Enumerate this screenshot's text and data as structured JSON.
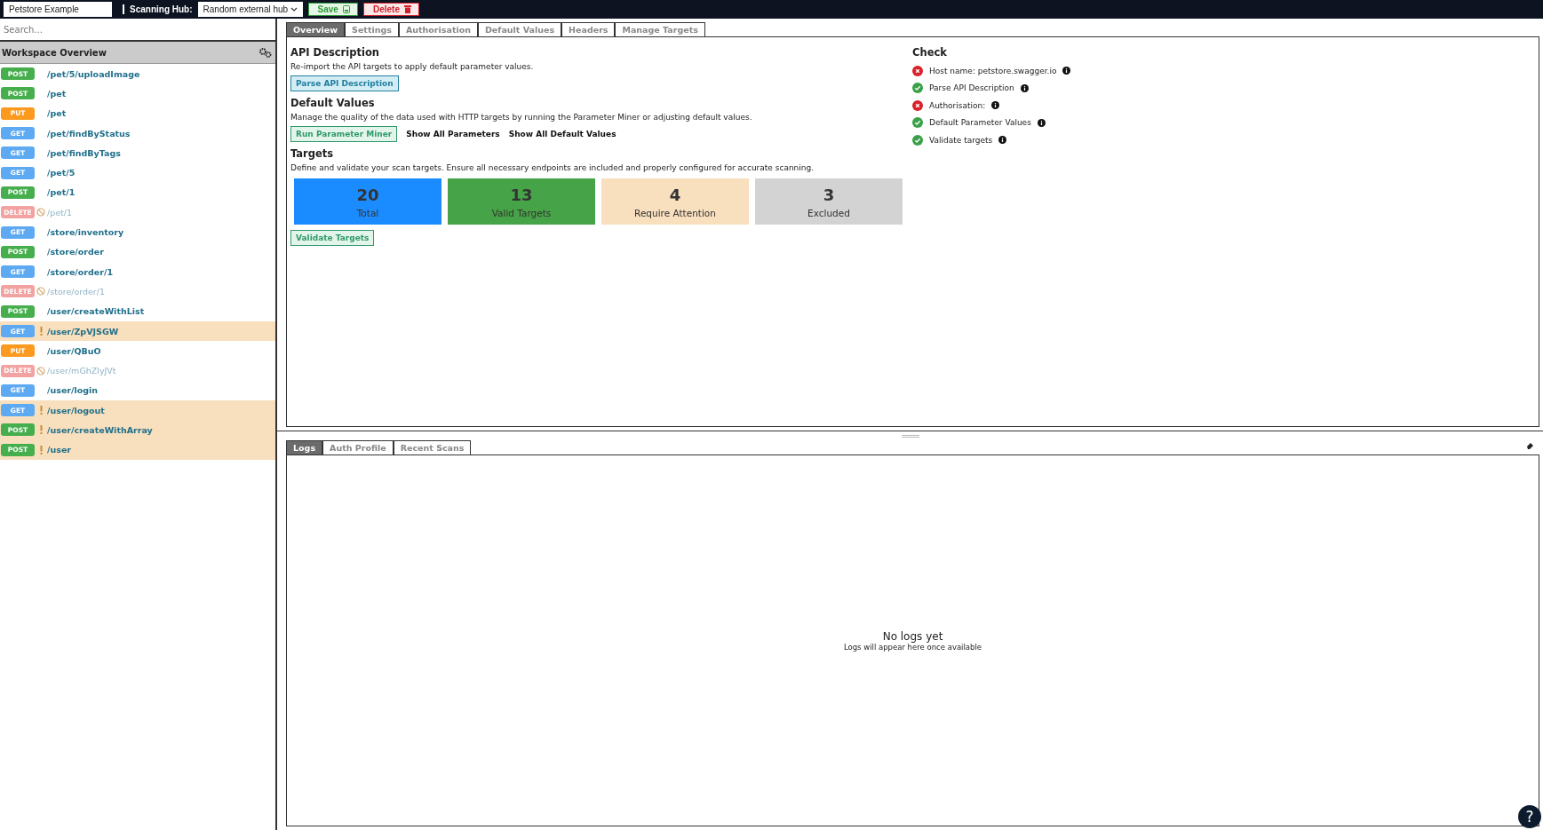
{
  "topbar": {
    "workspace_name": "Petstore Example",
    "hub_label": "Scanning Hub:",
    "hub_value": "Random external hub",
    "save": "Save",
    "delete": "Delete"
  },
  "sidebar": {
    "search_placeholder": "Search...",
    "title": "Workspace Overview",
    "endpoints": [
      {
        "method": "POST",
        "color": "#47ae4e",
        "path": "/pet/5/uploadImage",
        "kind": "normal"
      },
      {
        "method": "POST",
        "color": "#47ae4e",
        "path": "/pet",
        "kind": "normal"
      },
      {
        "method": "PUT",
        "color": "#fb9a1f",
        "path": "/pet",
        "kind": "normal"
      },
      {
        "method": "GET",
        "color": "#5eaaf2",
        "path": "/pet/findByStatus",
        "kind": "normal"
      },
      {
        "method": "GET",
        "color": "#5eaaf2",
        "path": "/pet/findByTags",
        "kind": "normal"
      },
      {
        "method": "GET",
        "color": "#5eaaf2",
        "path": "/pet/5",
        "kind": "normal"
      },
      {
        "method": "POST",
        "color": "#47ae4e",
        "path": "/pet/1",
        "kind": "normal"
      },
      {
        "method": "DELETE",
        "color": "#f3a2a2",
        "path": "/pet/1",
        "kind": "excluded"
      },
      {
        "method": "GET",
        "color": "#5eaaf2",
        "path": "/store/inventory",
        "kind": "normal"
      },
      {
        "method": "POST",
        "color": "#47ae4e",
        "path": "/store/order",
        "kind": "normal"
      },
      {
        "method": "GET",
        "color": "#5eaaf2",
        "path": "/store/order/1",
        "kind": "normal"
      },
      {
        "method": "DELETE",
        "color": "#f3a2a2",
        "path": "/store/order/1",
        "kind": "excluded"
      },
      {
        "method": "POST",
        "color": "#47ae4e",
        "path": "/user/createWithList",
        "kind": "normal"
      },
      {
        "method": "GET",
        "color": "#5eaaf2",
        "path": "/user/ZpVJSGW",
        "kind": "attention"
      },
      {
        "method": "PUT",
        "color": "#fb9a1f",
        "path": "/user/QBuO",
        "kind": "normal"
      },
      {
        "method": "DELETE",
        "color": "#f3a2a2",
        "path": "/user/mGhZlyJVt",
        "kind": "excluded"
      },
      {
        "method": "GET",
        "color": "#5eaaf2",
        "path": "/user/login",
        "kind": "normal"
      },
      {
        "method": "GET",
        "color": "#5eaaf2",
        "path": "/user/logout",
        "kind": "attention"
      },
      {
        "method": "POST",
        "color": "#47ae4e",
        "path": "/user/createWithArray",
        "kind": "attention"
      },
      {
        "method": "POST",
        "color": "#47ae4e",
        "path": "/user",
        "kind": "attention"
      }
    ]
  },
  "tabs": [
    {
      "label": "Overview",
      "selected": true
    },
    {
      "label": "Settings",
      "selected": false
    },
    {
      "label": "Authorisation",
      "selected": false
    },
    {
      "label": "Default Values",
      "selected": false
    },
    {
      "label": "Headers",
      "selected": false
    },
    {
      "label": "Manage Targets",
      "selected": false
    }
  ],
  "overview": {
    "api_description": {
      "heading": "API Description",
      "text": "Re-import the API targets to apply default parameter values.",
      "button": "Parse API Description"
    },
    "default_values": {
      "heading": "Default Values",
      "text": "Manage the quality of the data used with HTTP targets by running the Parameter Miner or adjusting default values.",
      "button": "Run Parameter Miner",
      "links": [
        "Show All Parameters",
        "Show All Default Values"
      ]
    },
    "targets": {
      "heading": "Targets",
      "text": "Define and validate your scan targets. Ensure all necessary endpoints are included and properly configured for accurate scanning.",
      "cards": [
        {
          "value": "20",
          "label": "Total",
          "color": "#1a8cff"
        },
        {
          "value": "13",
          "label": "Valid Targets",
          "color": "#47a347"
        },
        {
          "value": "4",
          "label": "Require Attention",
          "color": "#f8dfbd"
        },
        {
          "value": "3",
          "label": "Excluded",
          "color": "#d3d3d3"
        }
      ],
      "button": "Validate Targets"
    },
    "check": {
      "heading": "Check",
      "items": [
        {
          "label": "Host name: petstore.swagger.io",
          "passed": false
        },
        {
          "label": "Parse API Description",
          "passed": true
        },
        {
          "label": "Authorisation:",
          "passed": false
        },
        {
          "label": "Default Parameter Values",
          "passed": true
        },
        {
          "label": "Validate targets",
          "passed": true
        }
      ]
    }
  },
  "bottom_tabs": [
    {
      "label": "Logs",
      "selected": true
    },
    {
      "label": "Auth Profile",
      "selected": false
    },
    {
      "label": "Recent Scans",
      "selected": false
    }
  ],
  "logs": {
    "empty_title": "No logs yet",
    "empty_text": "Logs will appear here once available"
  },
  "help": "?"
}
